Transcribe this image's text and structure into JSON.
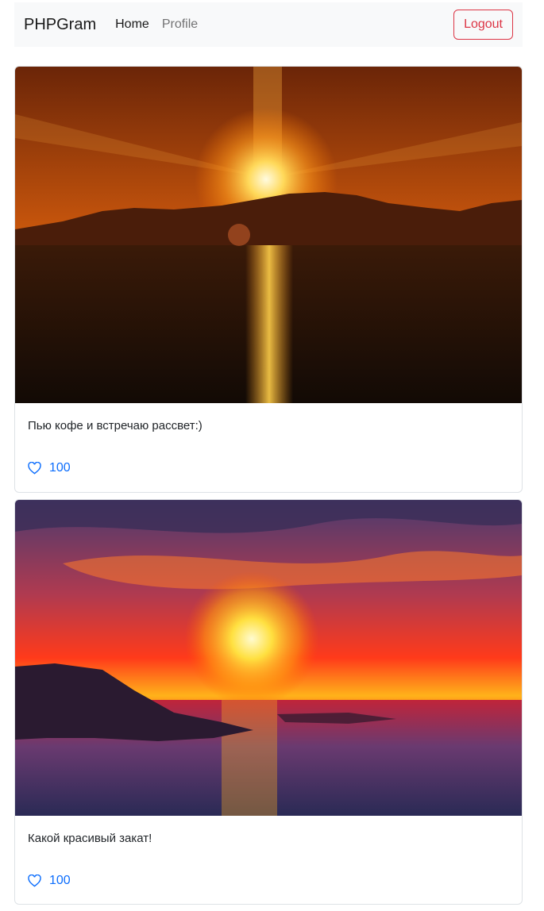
{
  "navbar": {
    "brand": "PHPGram",
    "links": [
      {
        "label": "Home"
      },
      {
        "label": "Profile"
      }
    ],
    "logout_label": "Logout"
  },
  "posts": [
    {
      "image_alt": "Sunrise over the sea with mountains",
      "caption": "Пью кофе и встречаю рассвет:)",
      "likes": "100",
      "like_icon": "heart-outline-icon"
    },
    {
      "image_alt": "Red sunset over the sea and rocky shore",
      "caption": "Какой красивый закат!",
      "likes": "100",
      "like_icon": "heart-outline-icon"
    }
  ],
  "colors": {
    "navbar_bg": "#f8f9fa",
    "logout": "#dc3545",
    "like": "#0d6efd"
  }
}
